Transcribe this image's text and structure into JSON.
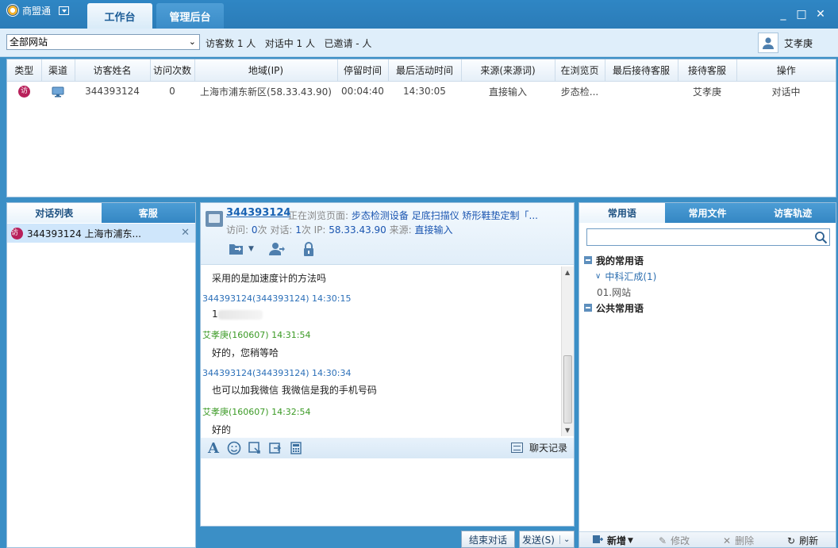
{
  "app": {
    "name": "商盟通",
    "tabs": [
      "工作台",
      "管理后台"
    ],
    "window_controls": [
      "_",
      "□",
      "✕"
    ]
  },
  "filter": {
    "site": "全部网站",
    "visitor_count": "访客数 1 人",
    "in_chat": "对话中 1 人",
    "invited": "已邀请 - 人",
    "user": "艾孝庚"
  },
  "visitor_table": {
    "headers": [
      "类型",
      "渠道",
      "访客姓名",
      "访问次数",
      "地域(IP)",
      "停留时间",
      "最后活动时间",
      "来源(来源词)",
      "在浏览页",
      "最后接待客服",
      "接待客服",
      "操作"
    ],
    "rows": [
      {
        "type_badge": "访",
        "name": "344393124",
        "visits": "0",
        "region": "上海市浦东新区(58.33.43.90)",
        "stay": "00:04:40",
        "last_active": "14:30:05",
        "source": "直接输入",
        "page": "步态检...",
        "last_agent": "",
        "agent": "艾孝庚",
        "action": "对话中"
      }
    ]
  },
  "left_panel": {
    "tabs": [
      "对话列表",
      "客服"
    ],
    "conversation": {
      "badge": "访",
      "label": "344393124 上海市浦东..."
    }
  },
  "chat": {
    "visitor_name": "344393124",
    "browsing_label": "正在浏览页面:",
    "browsing_pages": "步态检测设备 足底扫描仪 矫形鞋垫定制「...",
    "info_prefix": "访问: ",
    "visits": "0",
    "info_mid1": "次 对话: ",
    "chats": "1",
    "info_mid2": "次 IP: ",
    "ip": "58.33.43.90",
    "info_mid3": " 来源: ",
    "source": "直接输入",
    "first_line": "采用的是加速度计的方法吗",
    "messages": [
      {
        "who": "visitor",
        "meta": "344393124(344393124)  14:30:15",
        "text": "1"
      },
      {
        "who": "agent",
        "meta": "艾孝庚(160607)  14:31:54",
        "text": "好的，您稍等哈"
      },
      {
        "who": "visitor",
        "meta": "344393124(344393124)  14:30:34",
        "text": "也可以加我微信 我微信是我的手机号码"
      },
      {
        "who": "agent",
        "meta": "艾孝庚(160607)  14:32:54",
        "text": "好的"
      }
    ],
    "toolbar_font": "A",
    "history": "聊天记录",
    "end_button": "结束对话",
    "send_button": "发送(S)"
  },
  "right_panel": {
    "tabs": [
      "常用语",
      "常用文件",
      "访客轨迹"
    ],
    "search_placeholder": "",
    "tree": {
      "mine": "我的常用语",
      "group": "中科汇成(1)",
      "item": "01.网站",
      "public": "公共常用语"
    },
    "bottom": {
      "add": "新增",
      "edit": "修改",
      "delete": "删除",
      "refresh": "刷新"
    }
  }
}
